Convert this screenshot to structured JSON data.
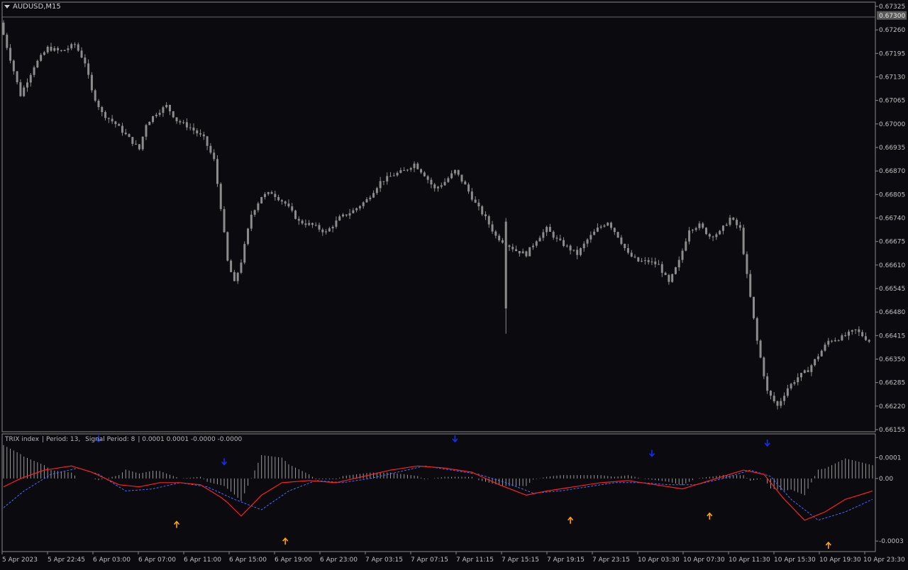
{
  "window": {
    "symbol": "AUDUSD,M15"
  },
  "price_axis": {
    "ticks": [
      "0.67325",
      "0.67260",
      "0.67195",
      "0.67130",
      "0.67065",
      "0.67000",
      "0.66935",
      "0.66870",
      "0.66805",
      "0.66740",
      "0.66675",
      "0.66610",
      "0.66545",
      "0.66480",
      "0.66415",
      "0.66350",
      "0.66285",
      "0.66220",
      "0.66155"
    ],
    "current": "0.67300",
    "range": [
      0.66155,
      0.67325
    ]
  },
  "indicator": {
    "name": "TRIX index",
    "period": "Period: 13,",
    "signal": "Signal Period: 8",
    "values": "0.0001 0.0001 -0.0000 -0.0000",
    "ticks": [
      "0.0001",
      "0.00",
      "-0.0003"
    ]
  },
  "time_axis": [
    "5 Apr 2023",
    "5 Apr 22:45",
    "6 Apr 03:00",
    "6 Apr 07:00",
    "6 Apr 11:00",
    "6 Apr 15:00",
    "6 Apr 19:00",
    "6 Apr 23:00",
    "7 Apr 03:15",
    "7 Apr 07:15",
    "7 Apr 11:15",
    "7 Apr 15:15",
    "7 Apr 19:15",
    "7 Apr 23:15",
    "10 Apr 03:30",
    "10 Apr 07:30",
    "10 Apr 11:30",
    "10 Apr 15:30",
    "10 Apr 19:30",
    "10 Apr 23:30"
  ],
  "colors": {
    "candle": "#8c8c8c",
    "trix": "#ff2020",
    "signal": "#4a6cff",
    "hist": "#9a9a9a",
    "up_arrow": "#ffa500",
    "down_arrow": "#1030ff"
  },
  "chart_data": {
    "type": "candlestick",
    "price_path": [
      [
        0,
        0.6728
      ],
      [
        3,
        0.6718
      ],
      [
        6,
        0.6708
      ],
      [
        10,
        0.6716
      ],
      [
        14,
        0.6721
      ],
      [
        18,
        0.672
      ],
      [
        22,
        0.6722
      ],
      [
        25,
        0.6717
      ],
      [
        27,
        0.6709
      ],
      [
        30,
        0.6703
      ],
      [
        34,
        0.67
      ],
      [
        38,
        0.6696
      ],
      [
        41,
        0.6693
      ],
      [
        43,
        0.67
      ],
      [
        46,
        0.6703
      ],
      [
        49,
        0.6705
      ],
      [
        52,
        0.6701
      ],
      [
        56,
        0.6699
      ],
      [
        60,
        0.6696
      ],
      [
        63,
        0.669
      ],
      [
        65,
        0.6677
      ],
      [
        67,
        0.6662
      ],
      [
        69,
        0.6656
      ],
      [
        71,
        0.6662
      ],
      [
        74,
        0.6675
      ],
      [
        77,
        0.668
      ],
      [
        80,
        0.6681
      ],
      [
        84,
        0.6678
      ],
      [
        88,
        0.6673
      ],
      [
        92,
        0.6672
      ],
      [
        96,
        0.667
      ],
      [
        100,
        0.6674
      ],
      [
        104,
        0.6676
      ],
      [
        108,
        0.6679
      ],
      [
        112,
        0.6684
      ],
      [
        116,
        0.6686
      ],
      [
        119,
        0.6687
      ],
      [
        122,
        0.6689
      ],
      [
        125,
        0.6686
      ],
      [
        128,
        0.6682
      ],
      [
        131,
        0.6684
      ],
      [
        134,
        0.6687
      ],
      [
        137,
        0.6683
      ],
      [
        140,
        0.6678
      ],
      [
        143,
        0.6674
      ],
      [
        146,
        0.6669
      ],
      [
        149,
        0.6667
      ],
      [
        152,
        0.6665
      ],
      [
        155,
        0.6664
      ],
      [
        158,
        0.6668
      ],
      [
        161,
        0.6671
      ],
      [
        164,
        0.6668
      ],
      [
        167,
        0.6666
      ],
      [
        170,
        0.6664
      ],
      [
        173,
        0.6668
      ],
      [
        176,
        0.6671
      ],
      [
        179,
        0.6673
      ],
      [
        182,
        0.6669
      ],
      [
        185,
        0.6664
      ],
      [
        188,
        0.6662
      ],
      [
        191,
        0.6662
      ],
      [
        194,
        0.6661
      ],
      [
        197,
        0.6656
      ],
      [
        200,
        0.6662
      ],
      [
        203,
        0.6671
      ],
      [
        206,
        0.6672
      ],
      [
        209,
        0.6669
      ],
      [
        212,
        0.667
      ],
      [
        215,
        0.6674
      ],
      [
        218,
        0.6671
      ],
      [
        220,
        0.6658
      ],
      [
        223,
        0.664
      ],
      [
        226,
        0.6626
      ],
      [
        229,
        0.6622
      ],
      [
        232,
        0.6627
      ],
      [
        235,
        0.663
      ],
      [
        238,
        0.6632
      ],
      [
        241,
        0.6636
      ],
      [
        244,
        0.664
      ],
      [
        248,
        0.6641
      ],
      [
        252,
        0.6643
      ],
      [
        256,
        0.664
      ]
    ],
    "trix_path": [
      [
        0,
        -4e-05
      ],
      [
        5,
        0.0
      ],
      [
        12,
        4e-05
      ],
      [
        20,
        6e-05
      ],
      [
        26,
        3e-05
      ],
      [
        34,
        -3e-05
      ],
      [
        40,
        -4e-05
      ],
      [
        46,
        -2e-05
      ],
      [
        52,
        -2e-05
      ],
      [
        58,
        -3e-05
      ],
      [
        65,
        -0.0001
      ],
      [
        70,
        -0.00018
      ],
      [
        76,
        -8e-05
      ],
      [
        82,
        -2e-05
      ],
      [
        90,
        -1e-05
      ],
      [
        98,
        -2e-05
      ],
      [
        106,
        1e-05
      ],
      [
        114,
        4e-05
      ],
      [
        122,
        6e-05
      ],
      [
        130,
        5e-05
      ],
      [
        138,
        3e-05
      ],
      [
        146,
        -3e-05
      ],
      [
        154,
        -8e-05
      ],
      [
        160,
        -6e-05
      ],
      [
        168,
        -4e-05
      ],
      [
        176,
        -2e-05
      ],
      [
        184,
        -1e-05
      ],
      [
        192,
        -3e-05
      ],
      [
        200,
        -5e-05
      ],
      [
        206,
        -2e-05
      ],
      [
        212,
        1e-05
      ],
      [
        218,
        4e-05
      ],
      [
        224,
        2e-05
      ],
      [
        230,
        -0.0001
      ],
      [
        236,
        -0.0002
      ],
      [
        242,
        -0.00016
      ],
      [
        248,
        -0.0001
      ],
      [
        256,
        -6e-05
      ]
    ],
    "signal_path": [
      [
        0,
        -0.00014
      ],
      [
        6,
        -6e-05
      ],
      [
        14,
        2e-05
      ],
      [
        22,
        5e-05
      ],
      [
        28,
        2e-05
      ],
      [
        36,
        -6e-05
      ],
      [
        44,
        -5e-05
      ],
      [
        52,
        -2e-05
      ],
      [
        60,
        -4e-05
      ],
      [
        68,
        -0.0001
      ],
      [
        76,
        -0.00015
      ],
      [
        84,
        -6e-05
      ],
      [
        92,
        -1e-05
      ],
      [
        100,
        -2e-05
      ],
      [
        108,
        0.0
      ],
      [
        116,
        3e-05
      ],
      [
        124,
        6e-05
      ],
      [
        132,
        4e-05
      ],
      [
        140,
        2e-05
      ],
      [
        148,
        -2e-05
      ],
      [
        156,
        -7e-05
      ],
      [
        164,
        -6e-05
      ],
      [
        172,
        -4e-05
      ],
      [
        180,
        -2e-05
      ],
      [
        188,
        -2e-05
      ],
      [
        196,
        -3e-05
      ],
      [
        204,
        -3e-05
      ],
      [
        212,
        0.0
      ],
      [
        220,
        4e-05
      ],
      [
        226,
        1e-05
      ],
      [
        232,
        -0.0001
      ],
      [
        240,
        -0.0002
      ],
      [
        248,
        -0.00016
      ],
      [
        256,
        -0.0001
      ]
    ],
    "up_arrows": [
      [
        51,
        -0.00022
      ],
      [
        83,
        -0.0003
      ],
      [
        167,
        -0.0002
      ],
      [
        208,
        -0.00018
      ],
      [
        243,
        -0.00032
      ]
    ],
    "down_arrows": [
      [
        28,
        0.00019
      ],
      [
        65,
        8e-05
      ],
      [
        133,
        0.00019
      ],
      [
        191,
        0.00012
      ],
      [
        225,
        0.00017
      ]
    ],
    "indicator_range": [
      -0.00033,
      0.00019
    ]
  }
}
